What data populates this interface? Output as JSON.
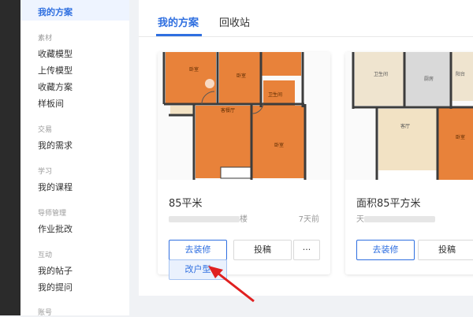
{
  "sidebar": {
    "active_item": "我的方案",
    "sections": [
      {
        "title": "素材",
        "items": [
          "收藏模型",
          "上传模型",
          "收藏方案",
          "样板间"
        ]
      },
      {
        "title": "交易",
        "items": [
          "我的需求"
        ]
      },
      {
        "title": "学习",
        "items": [
          "我的课程"
        ]
      },
      {
        "title": "导师管理",
        "items": [
          "作业批改"
        ]
      },
      {
        "title": "互动",
        "items": [
          "我的帖子",
          "我的提问"
        ]
      },
      {
        "title": "账号",
        "items": []
      }
    ]
  },
  "tabs": [
    "我的方案",
    "回收站"
  ],
  "cards": [
    {
      "title": "85平米",
      "meta_suffix": "楼",
      "time": "7天前",
      "buttons": [
        "去装修",
        "投稿",
        "···"
      ],
      "dropdown_item": "改户型"
    },
    {
      "title": "面积85平方米",
      "meta_prefix": "天",
      "buttons": [
        "去装修",
        "投稿"
      ]
    }
  ],
  "floorplan_labels": [
    "客餐厅",
    "卧室",
    "卧室",
    "卧室",
    "卫生间",
    "厨房",
    "阳台",
    "客厅",
    "卧室"
  ],
  "colors": {
    "accent": "#2f6fe0",
    "floor_wood": "#e8823a",
    "wall": "#3c3c3c"
  }
}
